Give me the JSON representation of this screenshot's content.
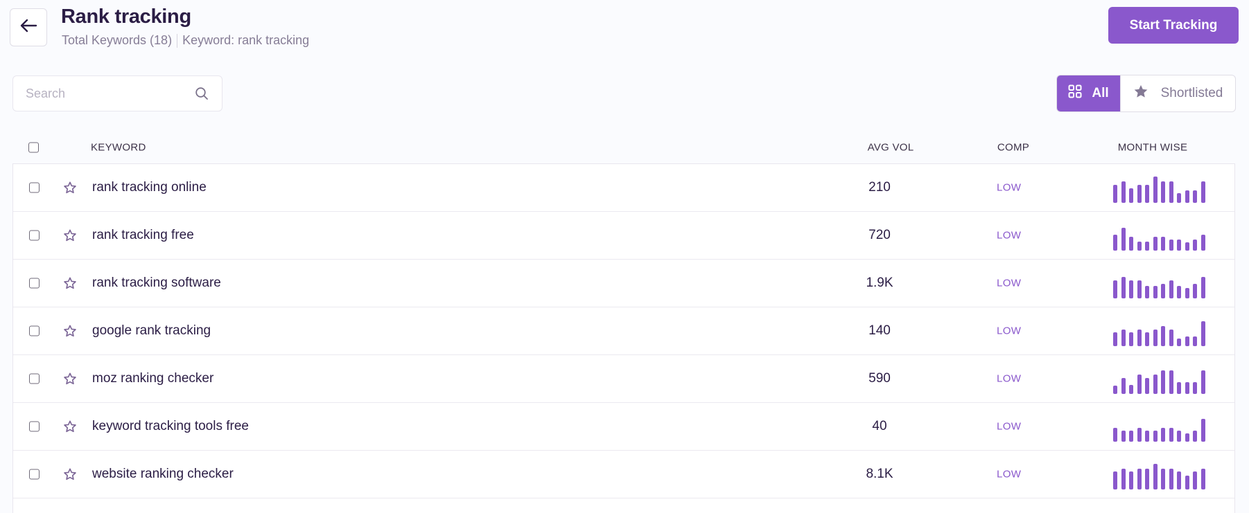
{
  "header": {
    "title": "Rank tracking",
    "total_keywords": "Total Keywords (18)",
    "keyword_label": "Keyword: rank tracking",
    "start_tracking_label": "Start Tracking"
  },
  "search": {
    "placeholder": "Search",
    "value": ""
  },
  "filter": {
    "all_label": "All",
    "shortlisted_label": "Shortlisted",
    "active": "All"
  },
  "colors": {
    "accent": "#8a58cc",
    "text": "#2b1d45",
    "muted": "#867d96"
  },
  "table": {
    "columns": {
      "keyword": "KEYWORD",
      "avg_vol": "AVG VOL",
      "comp": "COMP",
      "month_wise": "MONTH WISE"
    },
    "rows": [
      {
        "keyword": "rank tracking online",
        "avg_vol": "210",
        "comp": "LOW",
        "month_wise": [
          78,
          95,
          63,
          78,
          78,
          115,
          95,
          95,
          43,
          55,
          55,
          95
        ]
      },
      {
        "keyword": "rank tracking free",
        "avg_vol": "720",
        "comp": "LOW",
        "month_wise": [
          70,
          100,
          60,
          40,
          40,
          60,
          60,
          48,
          48,
          35,
          48,
          70
        ]
      },
      {
        "keyword": "rank tracking software",
        "avg_vol": "1.9K",
        "comp": "LOW",
        "month_wise": [
          78,
          95,
          78,
          78,
          55,
          55,
          65,
          78,
          55,
          45,
          65,
          95
        ]
      },
      {
        "keyword": "google rank tracking",
        "avg_vol": "140",
        "comp": "LOW",
        "month_wise": [
          60,
          72,
          60,
          72,
          60,
          72,
          88,
          72,
          33,
          42,
          42,
          108
        ]
      },
      {
        "keyword": "moz ranking checker",
        "avg_vol": "590",
        "comp": "LOW",
        "month_wise": [
          35,
          70,
          40,
          85,
          70,
          85,
          102,
          102,
          50,
          50,
          50,
          102
        ]
      },
      {
        "keyword": "keyword tracking tools free",
        "avg_vol": "40",
        "comp": "LOW",
        "month_wise": [
          60,
          47,
          47,
          60,
          47,
          47,
          60,
          60,
          47,
          35,
          47,
          100
        ]
      },
      {
        "keyword": "website ranking checker",
        "avg_vol": "8.1K",
        "comp": "LOW",
        "month_wise": [
          78,
          92,
          78,
          92,
          92,
          112,
          92,
          92,
          78,
          62,
          78,
          92
        ]
      }
    ]
  }
}
